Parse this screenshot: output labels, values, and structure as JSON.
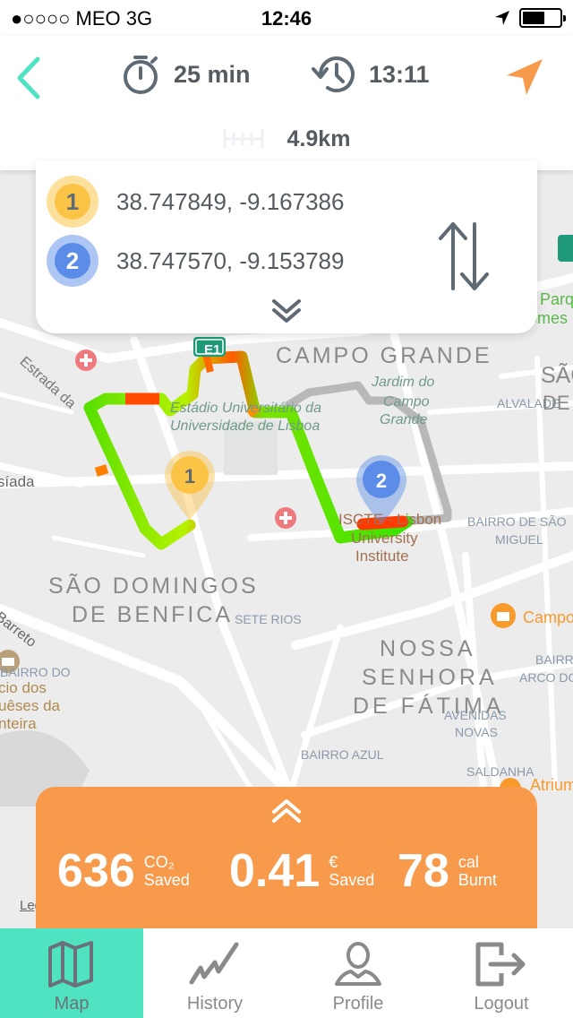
{
  "status_bar": {
    "carrier": "●○○○○ MEO   3G",
    "time": "12:46",
    "battery_level_percent": 60
  },
  "header": {
    "back_icon": "chevron-left-icon",
    "duration": "25 min",
    "duration_icon": "stopwatch-icon",
    "arrival_time": "13:11",
    "arrival_icon": "history-clock-icon",
    "navigate_icon": "navigation-arrow-icon",
    "distance": "4.9km",
    "distance_icon": "ruler-icon"
  },
  "waypoints": [
    {
      "number": "1",
      "coords": "38.747849, -9.167386",
      "color": "#fbc447"
    },
    {
      "number": "2",
      "coords": "38.747570, -9.153789",
      "color": "#5b8de8"
    }
  ],
  "map": {
    "labels": {
      "campo_grande": "CAMPO GRANDE",
      "jardim1": "Jardim do",
      "jardim2": "Campo",
      "jardim3": "Grande",
      "estadio1": "Estádio Universitário da",
      "estadio2": "Universidade de Lisboa",
      "estrada": "Estrada da",
      "lusiada": "Lusíada",
      "sao_domingos1": "SÃO DOMINGOS",
      "sao_domingos2": "DE BENFICA",
      "sete_rios": "SETE RIOS",
      "iscte1": "ISCTE - Lisbon",
      "iscte2": "University",
      "iscte3": "Institute",
      "alvalade": "ALVALADE",
      "sao_joao": "SÃO",
      "sao_joao2": "DE",
      "bairro_sao_miguel1": "BAIRRO DE SÃO",
      "bairro_sao_miguel2": "MIGUEL",
      "nossa1": "NOSSA",
      "nossa2": "SENHORA",
      "nossa3": "DE FÁTIMA",
      "avenidas1": "AVENIDAS",
      "avenidas2": "NOVAS",
      "bairro_azul": "BAIRRO AZUL",
      "saldanha": "SALDANHA",
      "campo_pequeno": "Campo",
      "atrium": "Atrium",
      "bairro_arco1": "BAIRRO",
      "bairro_arco2": "ARCO DO",
      "barreto": "Barreto",
      "bairro_do": "BAIRRO DO",
      "palacio1": "cio dos",
      "palacio2": "uêses da",
      "palacio3": "nteira",
      "parque1": "Parque",
      "parque2": "omes",
      "e1": "E1",
      "legal": "Legal"
    }
  },
  "stats": {
    "collapse_icon": "double-chevron-up-icon",
    "co2": {
      "value": "636",
      "line1": "CO₂",
      "line2": "Saved"
    },
    "money": {
      "value": "0.41",
      "line1": "€",
      "line2": "Saved"
    },
    "calories": {
      "value": "78",
      "line1": "cal",
      "line2": "Burnt"
    }
  },
  "tabs": [
    {
      "label": "Map",
      "icon": "map-icon",
      "active": true
    },
    {
      "label": "History",
      "icon": "chart-line-icon",
      "active": false
    },
    {
      "label": "Profile",
      "icon": "user-icon",
      "active": false
    },
    {
      "label": "Logout",
      "icon": "logout-icon",
      "active": false
    }
  ],
  "colors": {
    "accent": "#50e3c2",
    "orange": "#f89a4c",
    "icon_gray": "#5f6b74"
  }
}
